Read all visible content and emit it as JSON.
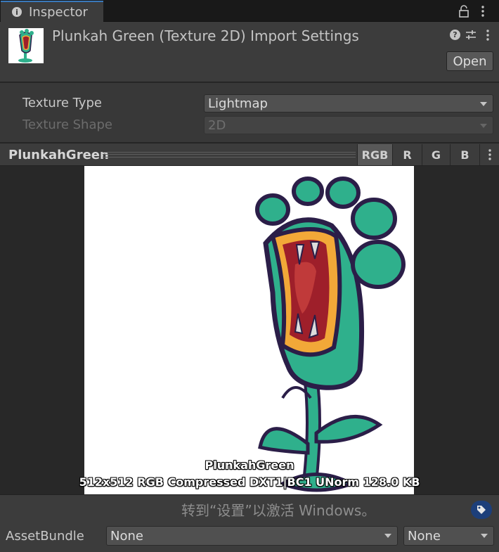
{
  "tab": {
    "title": "Inspector",
    "icon": "info-icon"
  },
  "header": {
    "title": "Plunkah Green (Texture 2D) Import Settings",
    "open_label": "Open",
    "help_icon": "?"
  },
  "settings": {
    "texture_type_label": "Texture Type",
    "texture_type_value": "Lightmap",
    "texture_shape_label": "Texture Shape",
    "texture_shape_value": "2D"
  },
  "preview": {
    "name": "PlunkahGreen",
    "channels": [
      "RGB",
      "R",
      "G",
      "B"
    ],
    "overlay_name": "PlunkahGreen",
    "overlay_info": "512x512  RGB Compressed DXT1|BC1 UNorm  128.0 KB"
  },
  "watermark": "转到“设置”以激活 Windows。",
  "asset_bundle": {
    "label": "AssetBundle",
    "name_value": "None",
    "variant_value": "None"
  },
  "colors": {
    "tab_accent": "#3a79bb",
    "panel_bg": "#3c3c3c",
    "creature_teal": "#2fb08c",
    "mouth_red": "#9e1f2a",
    "lip_orange": "#f2a838"
  }
}
